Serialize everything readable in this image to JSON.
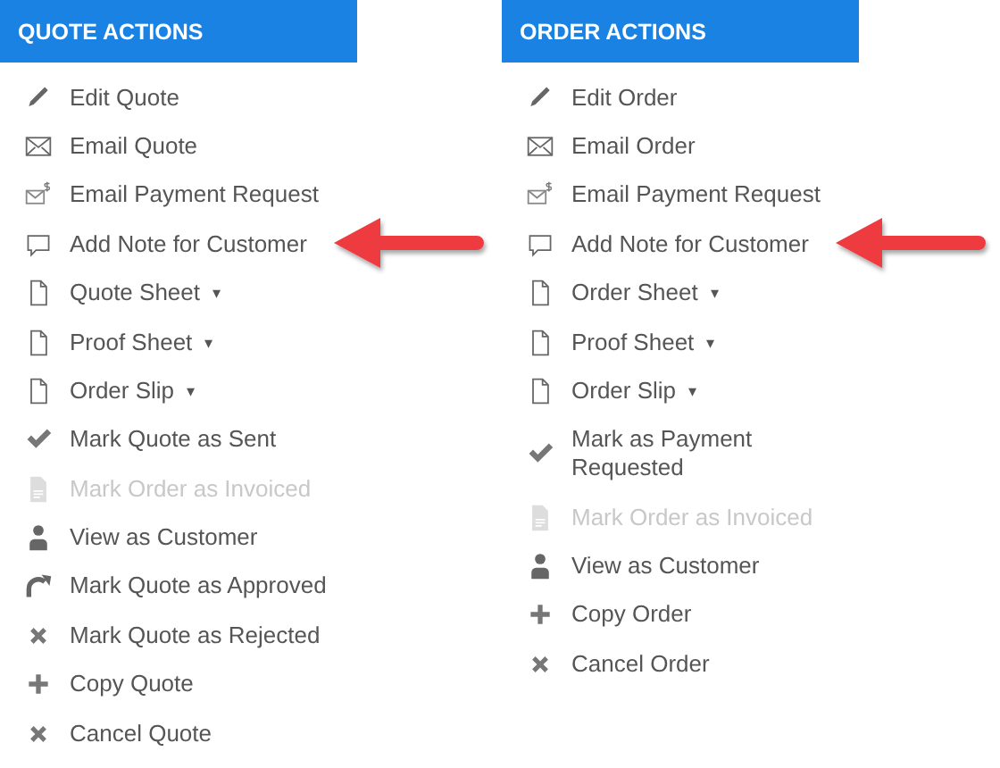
{
  "panels": [
    {
      "title": "QUOTE ACTIONS",
      "items": [
        {
          "kind": "edit",
          "label": "Edit Quote",
          "disabled": false,
          "arrow": false
        },
        {
          "kind": "email",
          "label": "Email Quote",
          "disabled": false,
          "arrow": false
        },
        {
          "kind": "payment-email",
          "label": "Email Payment Request",
          "disabled": false,
          "arrow": false
        },
        {
          "kind": "note",
          "label": "Add Note for Customer",
          "disabled": false,
          "arrow": true
        },
        {
          "kind": "sheet",
          "label": "Quote Sheet",
          "caret": "▾",
          "disabled": false,
          "arrow": false
        },
        {
          "kind": "sheet",
          "label": "Proof Sheet",
          "caret": "▾",
          "disabled": false,
          "arrow": false
        },
        {
          "kind": "sheet",
          "label": "Order Slip",
          "caret": "▾",
          "disabled": false,
          "arrow": false
        },
        {
          "kind": "check",
          "label": "Mark Quote as Sent",
          "disabled": false,
          "arrow": false
        },
        {
          "kind": "invoice",
          "label": "Mark Order as Invoiced",
          "disabled": true,
          "arrow": false
        },
        {
          "kind": "person",
          "label": "View as Customer",
          "disabled": false,
          "arrow": false
        },
        {
          "kind": "redo",
          "label": "Mark Quote as Approved",
          "disabled": false,
          "arrow": false
        },
        {
          "kind": "cross",
          "label": "Mark Quote as Rejected",
          "disabled": false,
          "arrow": false
        },
        {
          "kind": "plus",
          "label": "Copy Quote",
          "disabled": false,
          "arrow": false
        },
        {
          "kind": "cross",
          "label": "Cancel Quote",
          "disabled": false,
          "arrow": false
        }
      ]
    },
    {
      "title": "ORDER ACTIONS",
      "items": [
        {
          "kind": "edit",
          "label": "Edit Order",
          "disabled": false,
          "arrow": false
        },
        {
          "kind": "email",
          "label": "Email Order",
          "disabled": false,
          "arrow": false
        },
        {
          "kind": "payment-email",
          "label": "Email Payment Request",
          "disabled": false,
          "arrow": false
        },
        {
          "kind": "note",
          "label": "Add Note for Customer",
          "disabled": false,
          "arrow": true
        },
        {
          "kind": "sheet",
          "label": "Order Sheet",
          "caret": "▾",
          "disabled": false,
          "arrow": false
        },
        {
          "kind": "sheet",
          "label": "Proof Sheet",
          "caret": "▾",
          "disabled": false,
          "arrow": false
        },
        {
          "kind": "sheet",
          "label": "Order Slip",
          "caret": "▾",
          "disabled": false,
          "arrow": false
        },
        {
          "kind": "check",
          "label": "Mark as Payment Requested",
          "disabled": false,
          "arrow": false
        },
        {
          "kind": "invoice",
          "label": "Mark Order as Invoiced",
          "disabled": true,
          "arrow": false
        },
        {
          "kind": "person",
          "label": "View as Customer",
          "disabled": false,
          "arrow": false
        },
        {
          "kind": "plus",
          "label": "Copy Order",
          "disabled": false,
          "arrow": false
        },
        {
          "kind": "cross",
          "label": "Cancel Order",
          "disabled": false,
          "arrow": false
        }
      ]
    }
  ]
}
